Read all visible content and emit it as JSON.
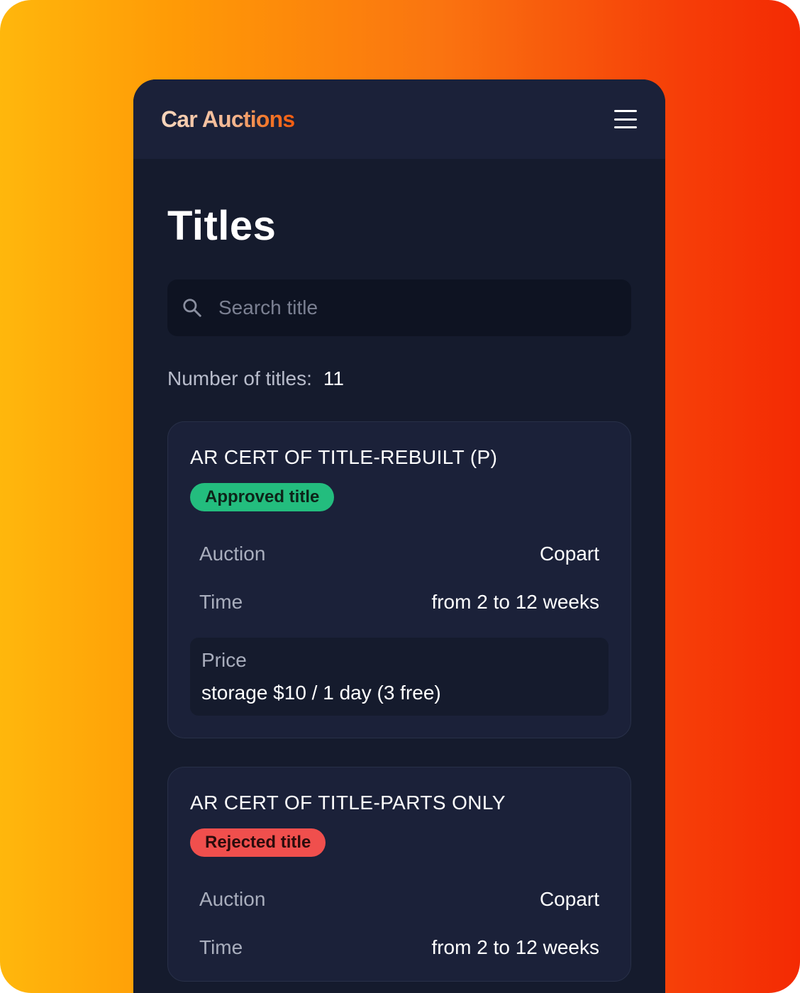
{
  "app": {
    "brand": "Car Auctions",
    "menu_icon": "hamburger-menu-icon"
  },
  "page": {
    "title": "Titles"
  },
  "search": {
    "placeholder": "Search title",
    "value": "",
    "icon": "search-icon"
  },
  "summary": {
    "label": "Number of titles:",
    "count": "11"
  },
  "labels": {
    "auction": "Auction",
    "time": "Time",
    "price": "Price"
  },
  "titles": [
    {
      "name": "AR CERT OF TITLE-REBUILT (P)",
      "status": "Approved title",
      "auction": "Copart",
      "time": "from 2 to 12 weeks",
      "price": "storage $10 / 1 day (3 free)"
    },
    {
      "name": "AR CERT OF TITLE-PARTS ONLY",
      "status": "Rejected title",
      "auction": "Copart",
      "time": "from 2 to 12 weeks"
    }
  ],
  "colors": {
    "approved": "#23bd7e",
    "rejected": "#f04f4d",
    "background_start": "#ffb70c",
    "background_end": "#f42a03",
    "panel": "#151b2d",
    "card": "#1b2139"
  }
}
